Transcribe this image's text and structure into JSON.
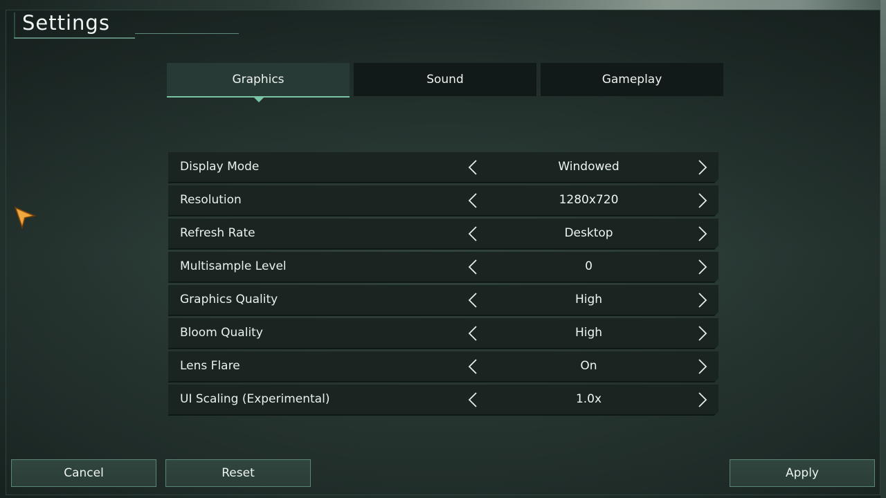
{
  "header": {
    "title": "Settings"
  },
  "tabs": [
    {
      "label": "Graphics",
      "active": true
    },
    {
      "label": "Sound",
      "active": false
    },
    {
      "label": "Gameplay",
      "active": false
    }
  ],
  "settings": [
    {
      "label": "Display Mode",
      "value": "Windowed"
    },
    {
      "label": "Resolution",
      "value": "1280x720"
    },
    {
      "label": "Refresh Rate",
      "value": "Desktop"
    },
    {
      "label": "Multisample Level",
      "value": "0"
    },
    {
      "label": "Graphics Quality",
      "value": "High"
    },
    {
      "label": "Bloom Quality",
      "value": "High"
    },
    {
      "label": "Lens Flare",
      "value": "On"
    },
    {
      "label": "UI Scaling (Experimental)",
      "value": "1.0x"
    }
  ],
  "footer": {
    "cancel_label": "Cancel",
    "reset_label": "Reset",
    "apply_label": "Apply"
  },
  "icons": {
    "prev": "chevron-left-icon",
    "next": "chevron-right-icon",
    "cursor": "pointer-cursor-icon"
  },
  "colors": {
    "accent": "#79c3a6",
    "cursor": "#e0902a",
    "row_bg": "#1a2522"
  }
}
